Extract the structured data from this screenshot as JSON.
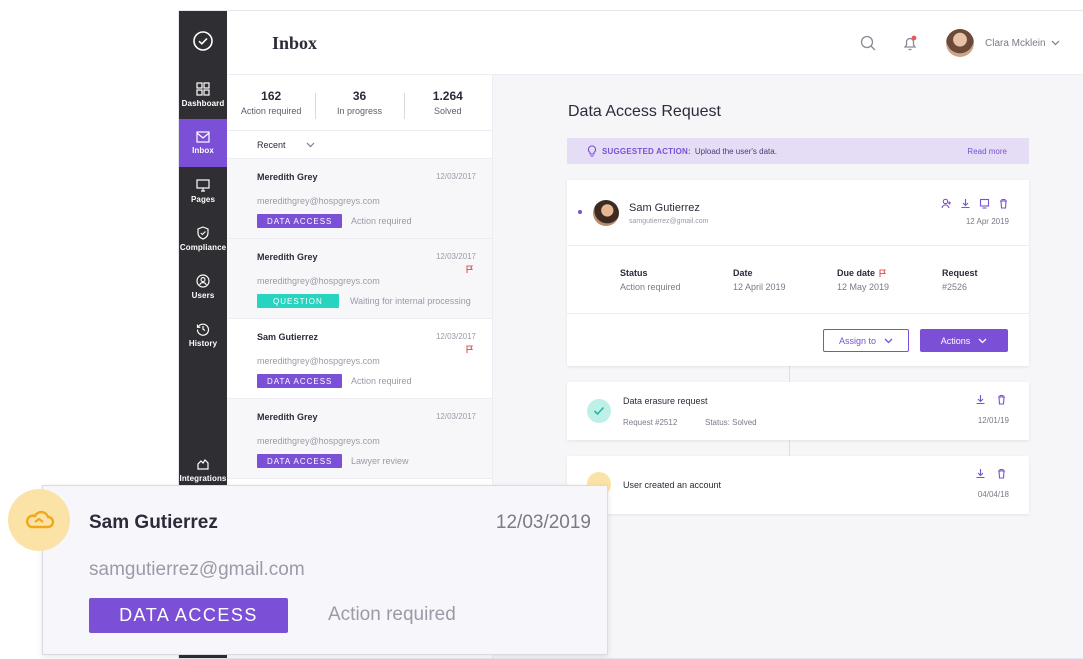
{
  "header": {
    "title": "Inbox",
    "user_name": "Clara Mcklein"
  },
  "sidebar": {
    "items": [
      {
        "label": "Dashboard",
        "icon": "grid-icon"
      },
      {
        "label": "Inbox",
        "icon": "mail-icon",
        "active": true
      },
      {
        "label": "Pages",
        "icon": "monitor-icon"
      },
      {
        "label": "Compliance",
        "icon": "shield-icon"
      },
      {
        "label": "Users",
        "icon": "user-icon"
      },
      {
        "label": "History",
        "icon": "history-icon"
      },
      {
        "label": "Integrations",
        "icon": "integrations-icon"
      }
    ]
  },
  "stats": [
    {
      "value": "162",
      "label": "Action required"
    },
    {
      "value": "36",
      "label": "In progress"
    },
    {
      "value": "1.264",
      "label": "Solved"
    }
  ],
  "filter": {
    "label": "Recent"
  },
  "inbox_items": [
    {
      "name": "Meredith Grey",
      "date": "12/03/2017",
      "email": "meredithgrey@hospgreys.com",
      "tag": "DATA ACCESS",
      "tag_color": "#7b4fd6",
      "status": "Action required",
      "flag": false
    },
    {
      "name": "Meredith Grey",
      "date": "12/03/2017",
      "email": "meredithgrey@hospgreys.com",
      "tag": "QUESTION",
      "tag_color": "#26d4c0",
      "status": "Waiting for internal processing",
      "flag": true
    },
    {
      "name": "Sam Gutierrez",
      "date": "12/03/2017",
      "email": "meredithgrey@hospgreys.com",
      "tag": "DATA ACCESS",
      "tag_color": "#7b4fd6",
      "status": "Action required",
      "flag": true
    },
    {
      "name": "Meredith Grey",
      "date": "12/03/2017",
      "email": "meredithgrey@hospgreys.com",
      "tag": "DATA ACCESS",
      "tag_color": "#7b4fd6",
      "status": "Lawyer review",
      "flag": false
    }
  ],
  "detail": {
    "title": "Data Access Request",
    "suggested_key": "SUGGESTED ACTION:",
    "suggested_text": "Upload the user's data.",
    "read_more": "Read more",
    "requester": {
      "name": "Sam Gutierrez",
      "email": "samgutierrez@gmail.com",
      "date": "12 Apr 2019"
    },
    "meta": [
      {
        "label": "Status",
        "value": "Action required"
      },
      {
        "label": "Date",
        "value": "12 April 2019"
      },
      {
        "label": "Due date",
        "value": "12 May 2019"
      },
      {
        "label": "Request",
        "value": "#2526"
      }
    ],
    "assign_label": "Assign to",
    "actions_label": "Actions",
    "timeline": [
      {
        "title": "Data erasure request",
        "request": "Request #2512",
        "status": "Status:  Solved",
        "date": "12/01/19"
      },
      {
        "title": "User created an account",
        "date": "04/04/18"
      }
    ]
  },
  "zoom": {
    "name": "Sam Gutierrez",
    "date": "12/03/2019",
    "email": "samgutierrez@gmail.com",
    "tag": "DATA ACCESS",
    "status": "Action required"
  },
  "colors": {
    "accent": "#7b4fd6",
    "teal": "#26d4c0",
    "sidebar": "#2e2e33",
    "flag": "#e85a5a"
  }
}
